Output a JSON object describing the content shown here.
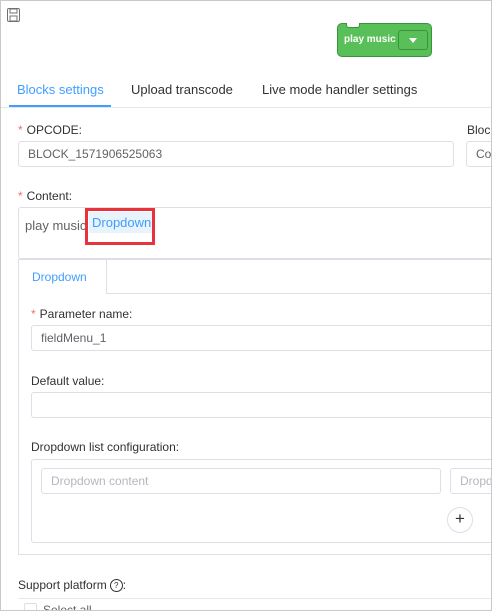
{
  "preview": {
    "block_label": "play music"
  },
  "tabs": [
    {
      "label": "Blocks settings",
      "active": true
    },
    {
      "label": "Upload transcode",
      "active": false
    },
    {
      "label": "Live mode handler settings",
      "active": false
    }
  ],
  "form": {
    "opcode": {
      "label": "OPCODE:",
      "value": "BLOCK_1571906525063"
    },
    "block_cut": {
      "label": "Block",
      "value": "Co"
    },
    "content": {
      "label": "Content:",
      "text": "play music",
      "chip": "Dropdown"
    },
    "param_tab": {
      "label": "Dropdown"
    },
    "parameter_name": {
      "label": "Parameter name:",
      "value": "fieldMenu_1"
    },
    "default_value": {
      "label": "Default value:",
      "value": ""
    },
    "dropdown_config": {
      "label": "Dropdown list configuration:",
      "content_placeholder": "Dropdown content",
      "value_placeholder": "Dropd"
    },
    "support_platform": {
      "label": "Support platform",
      "option": "Select all"
    }
  },
  "colors": {
    "accent": "#409eff",
    "required": "#f56c6c",
    "block_green": "#59c059",
    "highlight_red": "#e8323c"
  }
}
